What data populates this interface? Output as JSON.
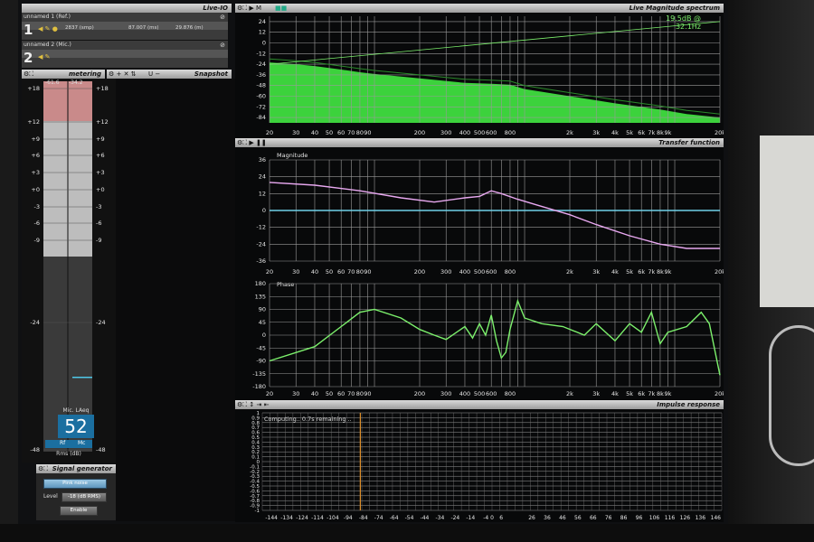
{
  "io_panel": {
    "title": "Live-IO",
    "channels": [
      {
        "name": "unnamed 1 (Ref.)",
        "number": "1",
        "samples": "2837 (smp)",
        "ms": "87.007 (ms)",
        "meters": "29.876 (m)"
      },
      {
        "name": "unnamed 2 (Mic.)",
        "number": "2"
      }
    ]
  },
  "metering": {
    "title": "metering",
    "peak_left": "-61.6",
    "peak_right": "-34.2",
    "scale": [
      "+18",
      "+12",
      "+9",
      "+6",
      "+3",
      "+0",
      "-3",
      "-6",
      "-9",
      "-24",
      "-48"
    ],
    "mic_label": "Mic. LAeq",
    "value": "52",
    "ref_label": "Rf",
    "mic_short": "Mc",
    "unit_label": "Rms (dB)"
  },
  "snapshot": {
    "title": "Snapshot",
    "icons": "U −"
  },
  "signal_generator": {
    "title": "Signal generator",
    "signal": "Pink noise",
    "level_label": "Level",
    "level_value": "-18 (dB RMS)",
    "enable_label": "Enable"
  },
  "spectrum": {
    "title": "Live Magnitude spectrum",
    "readout": "19.5dB @ 32.1Hz",
    "y_ticks": [
      "24",
      "12",
      "0",
      "-12",
      "-24",
      "-36",
      "-48",
      "-60",
      "-72",
      "-84"
    ],
    "x_ticks": [
      "20",
      "30",
      "40",
      "50",
      "60",
      "70",
      "80",
      "90",
      "200",
      "300",
      "400",
      "500",
      "600",
      "800",
      "2k",
      "3k",
      "4k",
      "5k",
      "6k",
      "7k",
      "8k",
      "9k",
      "20k"
    ]
  },
  "transfer": {
    "title": "Transfer function",
    "magnitude_label": "Magnitude",
    "mag_y_ticks": [
      "36",
      "24",
      "12",
      "0",
      "-12",
      "-24",
      "-36"
    ],
    "phase_label": "Phase",
    "phase_y_ticks": [
      "180",
      "135",
      "90",
      "45",
      "0",
      "-45",
      "-90",
      "-135",
      "-180"
    ],
    "x_ticks": [
      "20",
      "30",
      "40",
      "50",
      "60",
      "70",
      "80",
      "90",
      "200",
      "300",
      "400",
      "500",
      "600",
      "800",
      "2k",
      "3k",
      "4k",
      "5k",
      "6k",
      "7k",
      "8k",
      "9k",
      "20k"
    ]
  },
  "impulse": {
    "title": "Impulse response",
    "status": "Computing.. 0.7s remaining ..",
    "y_ticks": [
      "1",
      "0.9",
      "0.8",
      "0.7",
      "0.6",
      "0.5",
      "0.4",
      "0.3",
      "0.2",
      "0.1",
      "0",
      "-0.1",
      "-0.2",
      "-0.3",
      "-0.4",
      "-0.5",
      "-0.6",
      "-0.7",
      "-0.8",
      "-0.9",
      "-1"
    ],
    "x_ticks": [
      "-144",
      "-134",
      "-124",
      "-114",
      "-104",
      "-94",
      "-84",
      "-74",
      "-64",
      "-54",
      "-44",
      "-34",
      "-24",
      "-14",
      "-4",
      "0",
      "6",
      "26",
      "36",
      "46",
      "56",
      "66",
      "76",
      "86",
      "96",
      "106",
      "116",
      "126",
      "136",
      "146"
    ]
  },
  "colors": {
    "spectrum_fill": "#3cd23c",
    "mag_trace": "#e8a8f0",
    "ref_trace": "#6fd0e8",
    "phase_trace": "#7cf06c",
    "cursor": "#e0902a"
  }
}
